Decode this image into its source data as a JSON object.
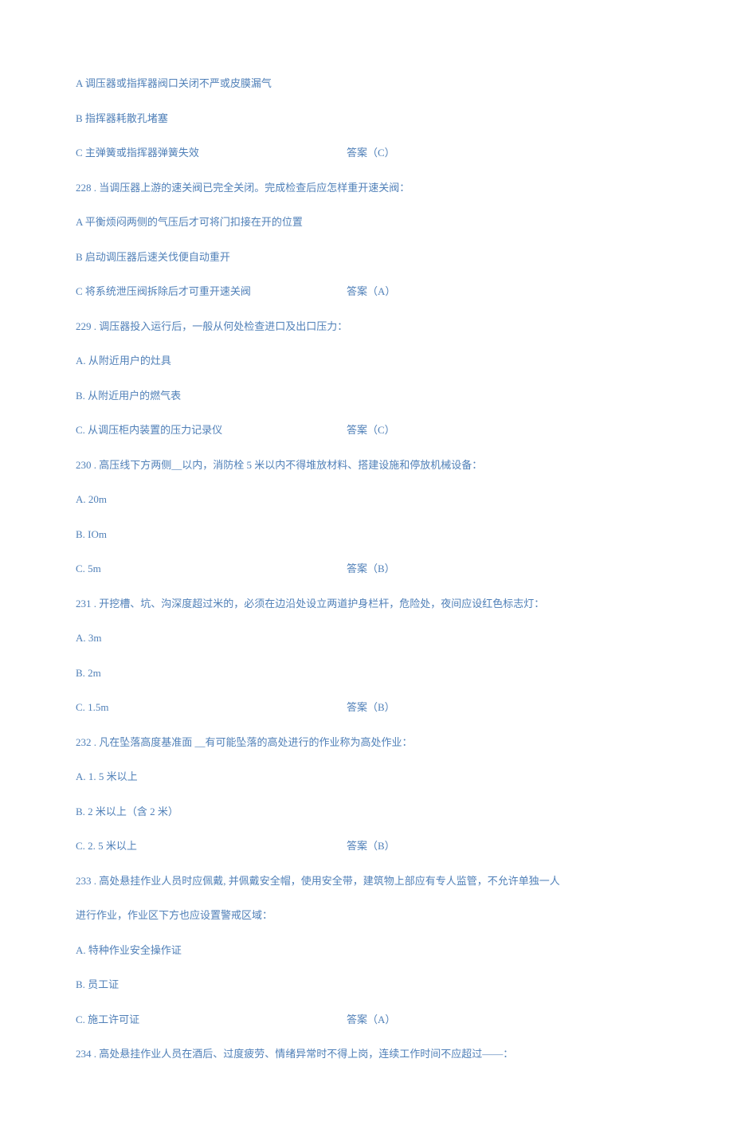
{
  "lines": [
    {
      "text": "A 调压器或指挥器阀口关闭不严或皮膜漏气"
    },
    {
      "text": "B 指挥器耗散孔堵塞"
    },
    {
      "text": "C 主弹簧或指挥器弹簧失效",
      "answer": "答案（C）"
    },
    {
      "text": "228  . 当调压器上游的速关阀已完全关闭。完成检查后应怎样重开速关阀："
    },
    {
      "text": "A 平衡烦闷两侧的气压后才可将门扣接在开的位置"
    },
    {
      "text": "B 启动调压器后速关伐便自动重开"
    },
    {
      "text": "C 将系统泄压阀拆除后才可重开速关阀",
      "answer": "答案（A）"
    },
    {
      "text": "229  . 调压器投入运行后，一般从何处检查进口及出口压力："
    },
    {
      "text": "A. 从附近用户的灶具"
    },
    {
      "text": "B. 从附近用户的燃气表"
    },
    {
      "text": "C. 从调压柜内装置的压力记录仪",
      "answer": "答案（C）"
    },
    {
      "text": "230  . 高压线下方两侧__以内，消防栓 5 米以内不得堆放材料、搭建设施和停放机械设备："
    },
    {
      "text": "A.  20m"
    },
    {
      "text": "B.  IOm"
    },
    {
      "text": "C.  5m",
      "answer": "答案（B）"
    },
    {
      "text": "231  . 开挖槽、坑、沟深度超过米的，必须在边沿处设立两道护身栏杆，危险处，夜间应设红色标志灯："
    },
    {
      "text": "A.  3m"
    },
    {
      "text": "B.  2m"
    },
    {
      "text": "C.  1.5m",
      "answer": "答案（B）"
    },
    {
      "text": "232  . 凡在坠落高度基准面 __有可能坠落的高处进行的作业称为高处作业："
    },
    {
      "text": "A. 1. 5 米以上"
    },
    {
      "text": "B. 2 米以上（含 2 米）"
    },
    {
      "text": "C. 2. 5 米以上",
      "answer": "答案（B）"
    },
    {
      "text": "233  . 高处悬挂作业人员时应佩戴, 并佩戴安全帽，使用安全带，建筑物上部应有专人监管，不允许单独一人"
    },
    {
      "text": "进行作业，作业区下方也应设置警戒区域："
    },
    {
      "text": "A. 特种作业安全操作证"
    },
    {
      "text": "B. 员工证"
    },
    {
      "text": "C. 施工许可证",
      "answer": "答案（A）"
    },
    {
      "text": "234  . 高处悬挂作业人员在酒后、过度疲劳、情绪异常时不得上岗，连续工作时间不应超过——："
    }
  ]
}
